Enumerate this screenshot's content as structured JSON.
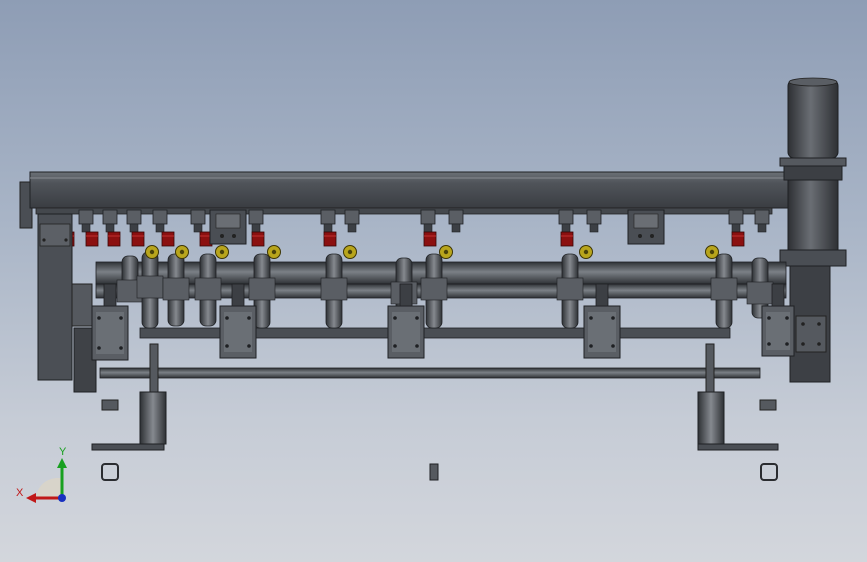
{
  "view": {
    "background_top": "#8e9db5",
    "background_bottom": "#d3d6dc"
  },
  "model": {
    "metal_dark": "#3c3f44",
    "metal_mid": "#5a5e64",
    "metal_light": "#8a8e94",
    "seal_color": "#8b1010",
    "knob_color": "#b8a51c",
    "motor_color": "#4a4d52"
  },
  "triad": {
    "x_label": "X",
    "y_label": "Y",
    "x_color": "#c01818",
    "y_color": "#18a020",
    "z_color": "#1830c0"
  }
}
